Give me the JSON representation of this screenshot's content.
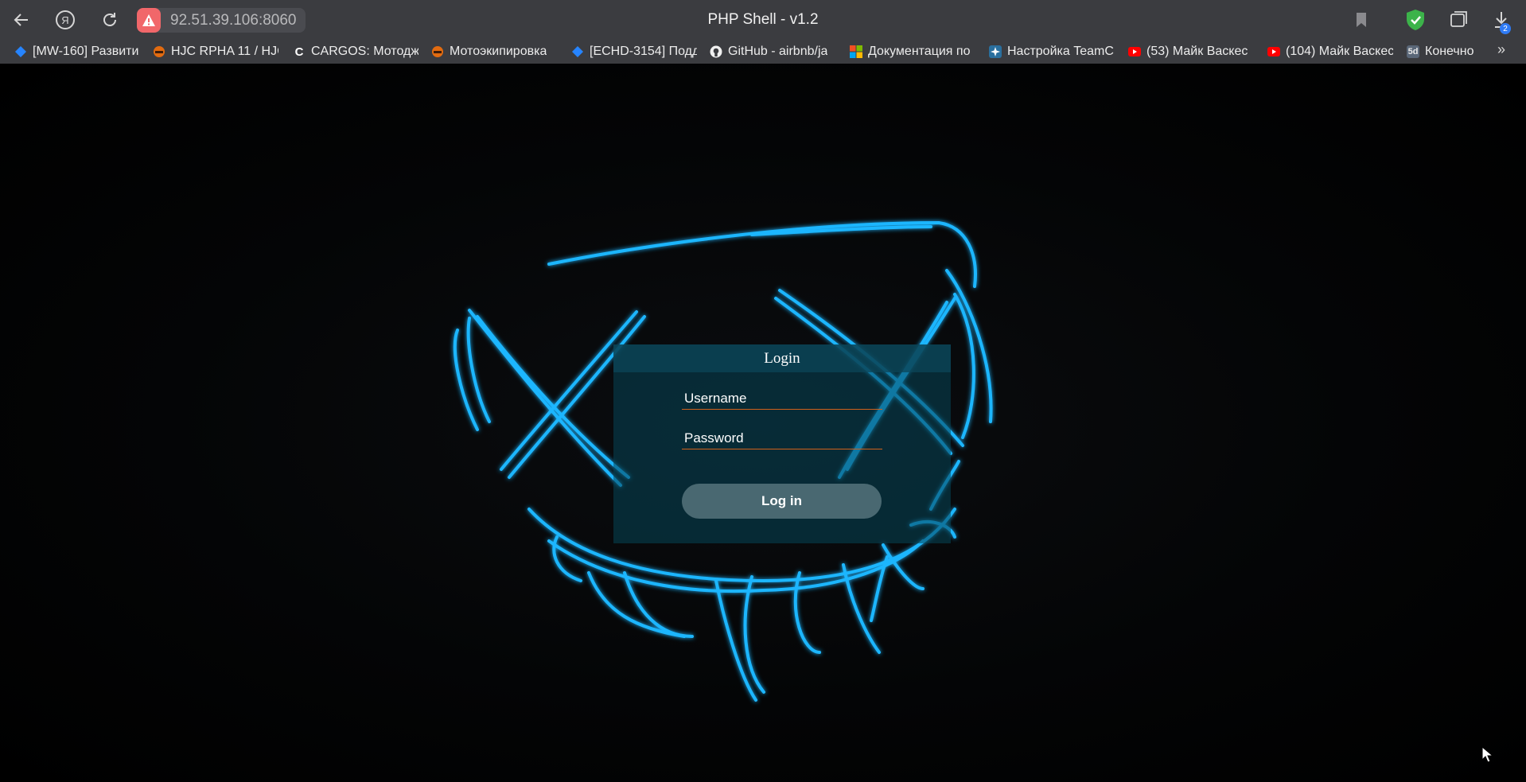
{
  "browser": {
    "address": "92.51.39.106:8060",
    "window_title": "PHP Shell - v1.2",
    "download_count": "2",
    "bookmarks": [
      {
        "label": "[MW-160] Развити",
        "icon": "jira-diamond-icon"
      },
      {
        "label": "HJC RPHA 11 / HJC",
        "icon": "moto-shop-icon"
      },
      {
        "label": "CARGOS: Мотодж",
        "icon": "cargos-icon"
      },
      {
        "label": "Мотоэкипировка",
        "icon": "moto-shop-icon"
      },
      {
        "label": "[ECHD-3154] Подд",
        "icon": "jira-diamond-icon"
      },
      {
        "label": "GitHub - airbnb/ja",
        "icon": "github-icon"
      },
      {
        "label": "Документация по",
        "icon": "microsoft-icon"
      },
      {
        "label": "Настройка TeamC",
        "icon": "teamcity-icon"
      },
      {
        "label": "(53) Майк Васкес",
        "icon": "youtube-icon"
      },
      {
        "label": "(104) Майк Васкес",
        "icon": "youtube-icon"
      },
      {
        "label": "Конечно",
        "icon": "5d-icon"
      }
    ]
  },
  "login": {
    "title": "Login",
    "username_placeholder": "Username",
    "password_placeholder": "Password",
    "submit_label": "Log in"
  },
  "colors": {
    "accent_underline": "#d1611c",
    "neon": "#1fb6ff",
    "panel": "#064658"
  }
}
